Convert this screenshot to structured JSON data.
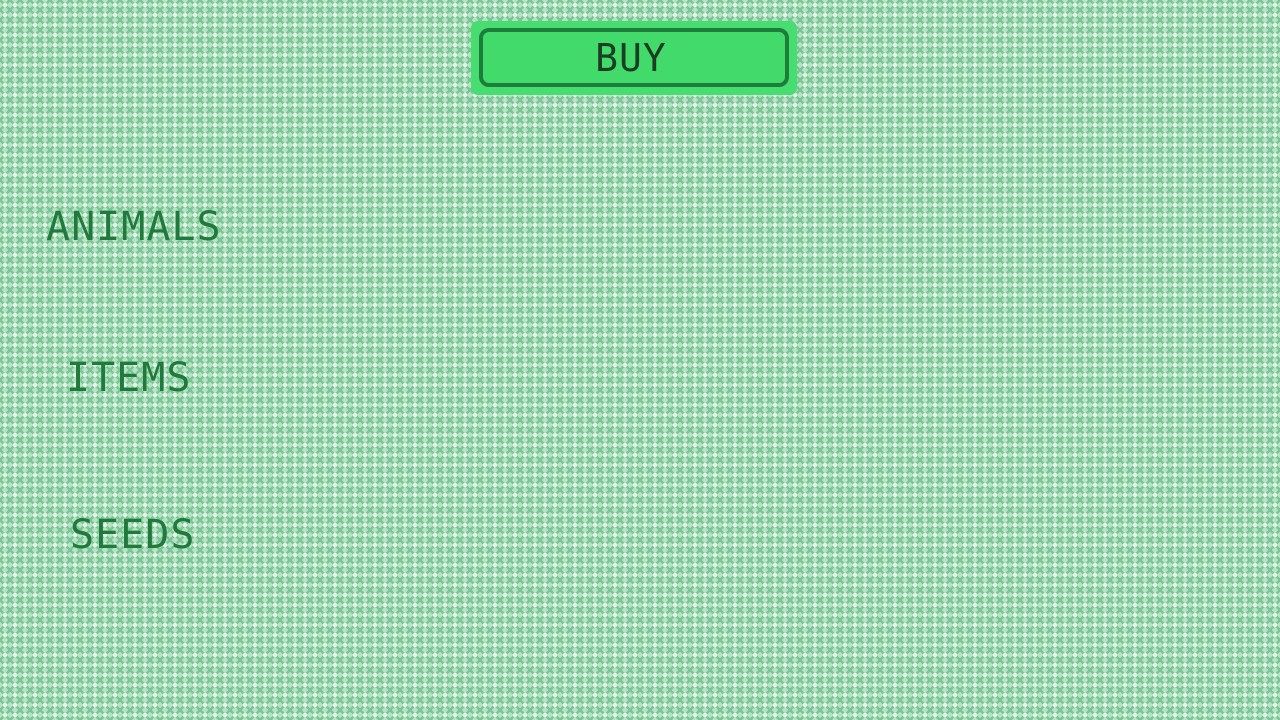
{
  "shop": {
    "buy_label": "BUY",
    "categories": [
      {
        "label": "ANIMALS"
      },
      {
        "label": "ITEMS"
      },
      {
        "label": "SEEDS"
      }
    ]
  },
  "colors": {
    "background": "#b8e4c6",
    "pattern": "#7cc596",
    "button_fill": "#47dd70",
    "button_border": "#1d7e3c",
    "button_text": "#1b3d24",
    "category_text": "#1f7a3c"
  }
}
